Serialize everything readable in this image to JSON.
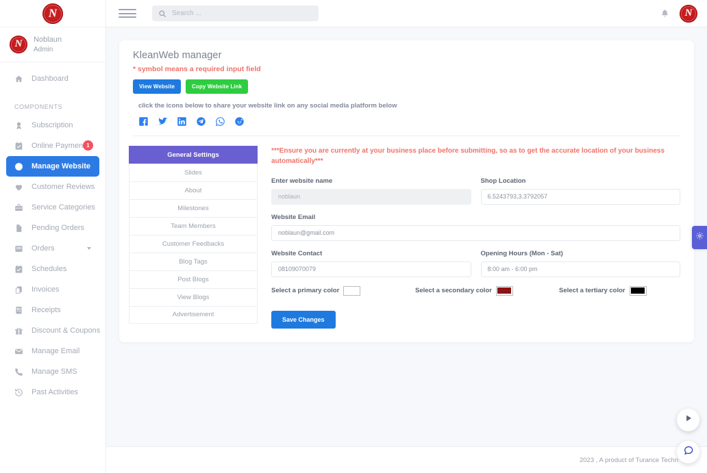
{
  "app": {
    "logo_name": "noblaun-logo"
  },
  "topbar": {
    "menu_icon": "hamburger-icon",
    "search": {
      "icon": "search-icon",
      "placeholder": "Search ...",
      "value": ""
    },
    "notification_icon": "bell-icon",
    "avatar_icon": "noblaun-logo"
  },
  "sidebar": {
    "profile": {
      "name": "Noblaun",
      "role": "Admin"
    },
    "items": [
      {
        "label": "Dashboard",
        "icon": "home-icon",
        "active": false,
        "badge": null,
        "caret": false
      },
      {
        "label": "Subscription",
        "icon": "award-icon",
        "active": false,
        "badge": null,
        "caret": false
      },
      {
        "label": "Online Payments",
        "icon": "calendar-check-icon",
        "active": false,
        "badge": "1",
        "caret": false
      },
      {
        "label": "Manage Website",
        "icon": "globe-icon",
        "active": true,
        "badge": null,
        "caret": false
      },
      {
        "label": "Customer Reviews",
        "icon": "heart-icon",
        "active": false,
        "badge": null,
        "caret": false
      },
      {
        "label": "Service Categories",
        "icon": "briefcase-icon",
        "active": false,
        "badge": null,
        "caret": false
      },
      {
        "label": "Pending Orders",
        "icon": "file-icon",
        "active": false,
        "badge": null,
        "caret": false
      },
      {
        "label": "Orders",
        "icon": "inbox-icon",
        "active": false,
        "badge": null,
        "caret": true
      },
      {
        "label": "Schedules",
        "icon": "calendar-check-icon",
        "active": false,
        "badge": null,
        "caret": false
      },
      {
        "label": "Invoices",
        "icon": "copy-icon",
        "active": false,
        "badge": null,
        "caret": false
      },
      {
        "label": "Receipts",
        "icon": "receipt-icon",
        "active": false,
        "badge": null,
        "caret": false
      },
      {
        "label": "Discount & Coupons",
        "icon": "gift-icon",
        "active": false,
        "badge": null,
        "caret": false
      },
      {
        "label": "Manage Email",
        "icon": "envelope-icon",
        "active": false,
        "badge": null,
        "caret": false
      },
      {
        "label": "Manage SMS",
        "icon": "phone-icon",
        "active": false,
        "badge": null,
        "caret": false
      },
      {
        "label": "Past Activities",
        "icon": "history-icon",
        "active": false,
        "badge": null,
        "caret": false
      }
    ],
    "section_label": "COMPONENTS"
  },
  "main": {
    "page_title": "KleanWeb manager",
    "required_note": "* symbol means a required input field",
    "view_website_label": "View Website",
    "copy_link_label": "Copy Website Link",
    "share_note": "click the icons below to share your website link on any social media platform below",
    "social_icons": [
      {
        "name": "facebook-icon"
      },
      {
        "name": "twitter-icon"
      },
      {
        "name": "linkedin-icon"
      },
      {
        "name": "telegram-icon"
      },
      {
        "name": "whatsapp-icon"
      },
      {
        "name": "reddit-icon"
      }
    ],
    "tabs": [
      {
        "label": "General Settings",
        "active": true
      },
      {
        "label": "Slides",
        "active": false
      },
      {
        "label": "About",
        "active": false
      },
      {
        "label": "Milestones",
        "active": false
      },
      {
        "label": "Team Members",
        "active": false
      },
      {
        "label": "Customer Feedbacks",
        "active": false
      },
      {
        "label": "Blog Tags",
        "active": false
      },
      {
        "label": "Post Blogs",
        "active": false
      },
      {
        "label": "View Blogs",
        "active": false
      },
      {
        "label": "Advertisement",
        "active": false
      }
    ],
    "form": {
      "warning": "***Ensure you are currently at your business place before submitting, so as to get the accurate location of your business automatically***",
      "website_name": {
        "label": "Enter website name",
        "value": "noblaun",
        "disabled": true
      },
      "shop_location": {
        "label": "Shop Location",
        "value": "6.5243793,3.3792057"
      },
      "website_email": {
        "label": "Website Email",
        "value": "noblaun@gmail.com"
      },
      "website_contact": {
        "label": "Website Contact",
        "value": "08109070079"
      },
      "opening_hours": {
        "label": "Opening Hours (Mon - Sat)",
        "value": "8:00 am - 6:00 pm"
      },
      "primary_color": {
        "label": "Select a primary color",
        "value": "#ffffff"
      },
      "secondary_color": {
        "label": "Select a secondary color",
        "value": "#8b1414"
      },
      "tertiary_color": {
        "label": "Select a tertiary color",
        "value": "#000000"
      },
      "save_label": "Save Changes"
    }
  },
  "footer": {
    "text": "2023 , A product of Turance Techn"
  },
  "floating": {
    "settings_tab_icon": "gear-icon",
    "play_icon": "play-icon",
    "chat_icon": "chat-bubble-icon"
  },
  "colors": {
    "primary_blue": "#2c7be5",
    "accent_green": "#2ecc40",
    "tab_purple": "#6a5fd0",
    "warn_red": "#f0726a",
    "brand_red": "#c0191c"
  }
}
